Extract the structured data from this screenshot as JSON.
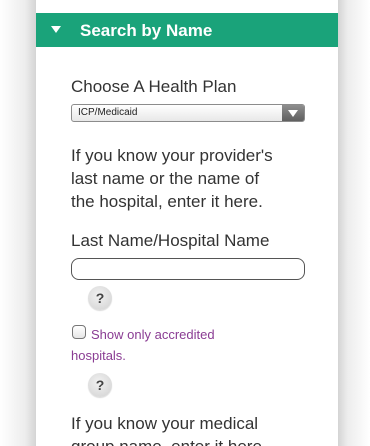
{
  "panel": {
    "title": "Search by Name",
    "header_color": "#1aa37a"
  },
  "health_plan": {
    "label": "Choose A Health Plan",
    "selected": "ICP/Medicaid"
  },
  "provider_hint": {
    "line1": "If you know your provider's",
    "line2": "last name or the name of",
    "line3": "the hospital, enter it here."
  },
  "last_name": {
    "label": "Last Name/Hospital Name",
    "value": ""
  },
  "help": {
    "symbol": "?"
  },
  "accredited": {
    "line1": "Show only accredited",
    "line2": "hospitals.",
    "checked": false,
    "color": "#8a3c93"
  },
  "medical_hint": {
    "line1": "If you know your medical",
    "line2": "group name, enter it here."
  }
}
